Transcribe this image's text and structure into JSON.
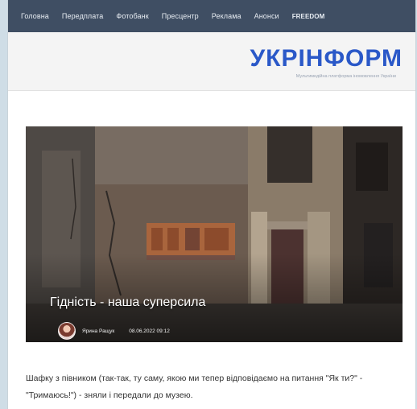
{
  "topnav": {
    "items": [
      "Головна",
      "Передплата",
      "Фотобанк",
      "Пресцентр",
      "Реклама",
      "Анонси",
      "FREEDOM"
    ]
  },
  "masthead": {
    "logo": "УКРІНФОРМ",
    "tagline": "Мультимедійна платформа іномовлення України"
  },
  "article": {
    "title": "Гідність - наша суперсила",
    "author": "Ярина Ращук",
    "date": "08.06.2022 09:12",
    "summary": "Шафку з півником (так-так, ту саму, якою ми тепер відповідаємо на питання \"Як ти?\" - \"Тримаюсь!\") - зняли і передали до музею."
  },
  "colors": {
    "page_background": "#cfdde6",
    "nav_background": "#3f4e63",
    "nav_text": "#e8edf3",
    "logo": "#2a58c8",
    "masthead_background": "#f4f4f4"
  },
  "icons": {
    "avatar": "author-photo"
  }
}
